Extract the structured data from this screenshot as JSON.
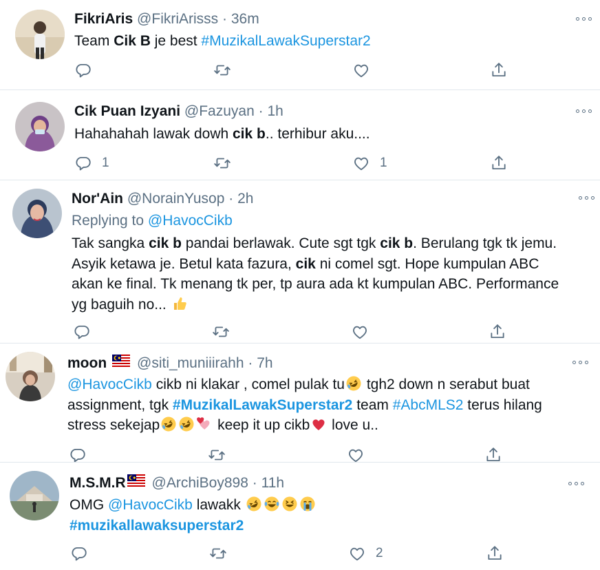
{
  "tweets": [
    {
      "name": "FikriAris",
      "handle": "@FikriArisss",
      "time": "36m",
      "body": [
        {
          "t": "Team "
        },
        {
          "t": "Cik B",
          "s": "bold"
        },
        {
          "t": " je best "
        },
        {
          "t": "#MuzikalLawakSuperstar2",
          "s": "link"
        }
      ],
      "counts": {
        "reply": "",
        "retweet": "",
        "like": ""
      }
    },
    {
      "name": "Cik Puan Izyani",
      "handle": "@Fazuyan",
      "time": "1h",
      "body": [
        {
          "t": "Hahahahah lawak dowh "
        },
        {
          "t": "cik b",
          "s": "bold"
        },
        {
          "t": ".. terhibur aku...."
        }
      ],
      "counts": {
        "reply": "1",
        "retweet": "",
        "like": "1"
      }
    },
    {
      "name": "Nor'Ain",
      "handle": "@NorainYusop",
      "time": "2h",
      "replying_prefix": "Replying to ",
      "replying_handle": "@HavocCikb",
      "body": [
        {
          "t": "Tak sangka "
        },
        {
          "t": "cik b",
          "s": "bold"
        },
        {
          "t": " pandai berlawak. Cute sgt tgk "
        },
        {
          "t": "cik b",
          "s": "bold"
        },
        {
          "t": ". Berulang tgk tk jemu."
        },
        {
          "br": true
        },
        {
          "t": "Asyik ketawa je. Betul kata fazura, "
        },
        {
          "t": "cik",
          "s": "bold"
        },
        {
          "t": " ni comel sgt. Hope kumpulan ABC"
        },
        {
          "br": true
        },
        {
          "t": "akan ke final. Tk menang tk per, tp aura ada kt kumpulan ABC. Performance"
        },
        {
          "br": true
        },
        {
          "t": "yg baguih no... "
        },
        {
          "e": "thumbs-up"
        }
      ],
      "counts": {
        "reply": "",
        "retweet": "",
        "like": ""
      }
    },
    {
      "name": "moon",
      "handle": "@siti_muniiirahh",
      "time": "7h",
      "flag": true,
      "body": [
        {
          "t": "@HavocCikb",
          "s": "link"
        },
        {
          "t": " cikb ni klakar , comel pulak tu"
        },
        {
          "e": "rofl"
        },
        {
          "t": " tgh2 down n serabut buat"
        },
        {
          "br": true
        },
        {
          "t": "assignment, tgk "
        },
        {
          "t": "#MuzikalLawakSuperstar2",
          "s": "linkbold"
        },
        {
          "t": " team "
        },
        {
          "t": "#AbcMLS2",
          "s": "link"
        },
        {
          "t": " terus hilang"
        },
        {
          "br": true
        },
        {
          "t": "stress sekejap"
        },
        {
          "e": "rofl"
        },
        {
          "e": "rofl"
        },
        {
          "e": "two-hearts"
        },
        {
          "t": " keep it up cikb"
        },
        {
          "e": "red-heart"
        },
        {
          "t": " love u.."
        }
      ],
      "counts": {
        "reply": "",
        "retweet": "",
        "like": ""
      }
    },
    {
      "name": "M.S.M.R",
      "handle": "@ArchiBoy898",
      "time": "11h",
      "flag": true,
      "body": [
        {
          "t": "OMG "
        },
        {
          "t": "@HavocCikb",
          "s": "link"
        },
        {
          "t": " lawakk "
        },
        {
          "e": "rofl"
        },
        {
          "e": "joy"
        },
        {
          "e": "grin-squint"
        },
        {
          "e": "sob"
        },
        {
          "br": true
        },
        {
          "t": "#muzikallawaksuperstar2",
          "s": "linkbold"
        }
      ],
      "counts": {
        "reply": "",
        "retweet": "",
        "like": "2"
      }
    }
  ],
  "colors": {
    "text": "#0f1419",
    "muted": "#5b7083",
    "link": "#1b95e0",
    "divider": "#e1e8ed"
  },
  "icons": [
    "reply-icon",
    "retweet-icon",
    "like-icon",
    "share-icon",
    "more-icon",
    "malaysia-flag-icon"
  ]
}
